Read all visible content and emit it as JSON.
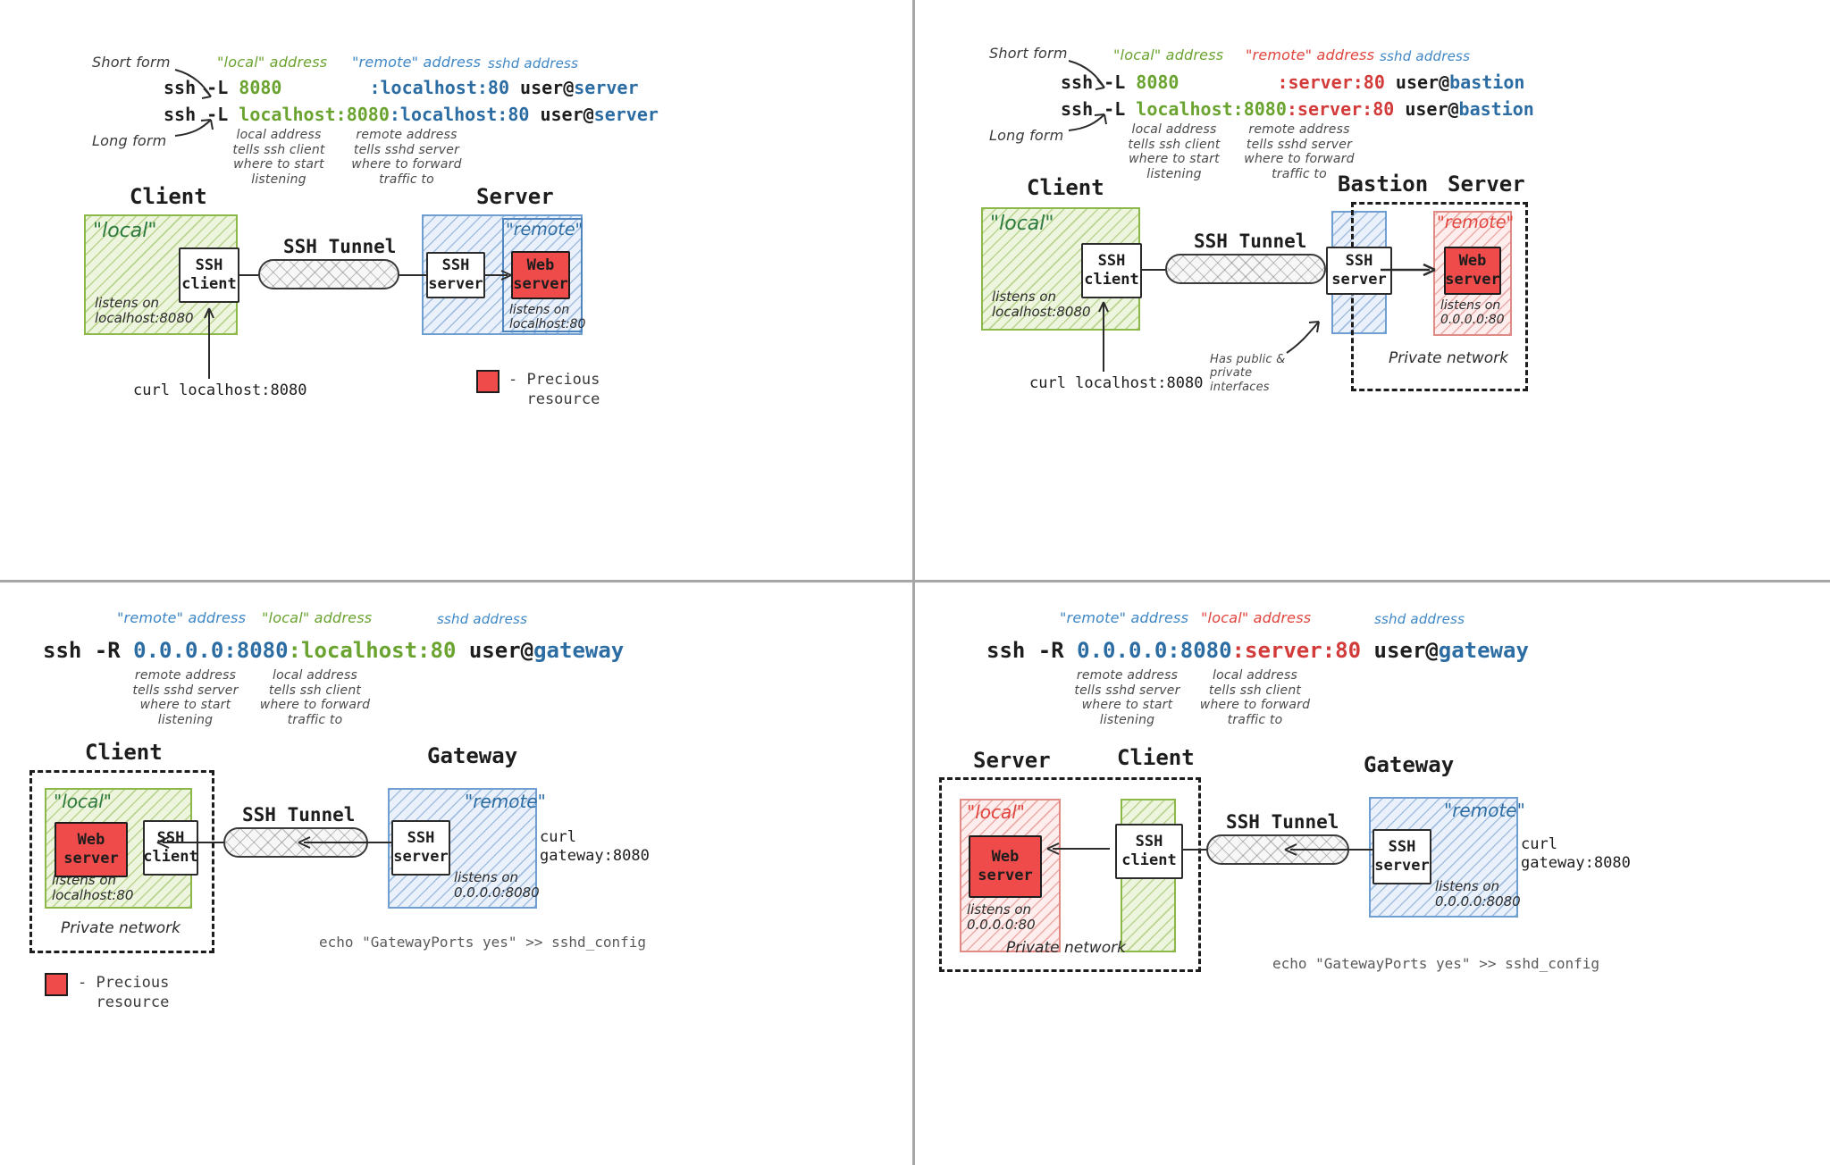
{
  "panels": {
    "top_left": {
      "labels": {
        "short_form": "Short form",
        "long_form": "Long form",
        "local_address": "\"local\" address",
        "remote_address": "\"remote\" address",
        "sshd_address": "sshd address"
      },
      "command_short": {
        "prefix": "ssh -L ",
        "local": "8080",
        "remote": ":localhost:80",
        "user": " user@",
        "host": "server"
      },
      "command_long": {
        "prefix": "ssh -L ",
        "local": "localhost:8080",
        "remote": ":localhost:80",
        "user": " user@",
        "host": "server"
      },
      "note_local": "local address\ntells ssh client\nwhere to start\nlistening",
      "note_remote": "remote address\ntells sshd server\nwhere to forward\ntraffic to",
      "host_left": "Client",
      "host_right": "Server",
      "zone_left_label": "\"local\"",
      "zone_right_label": "\"remote\"",
      "zone_left_note": "listens on\nlocalhost:8080",
      "zone_right_note": "listens on\nlocalhost:80",
      "node_ssh_client": "SSH\nclient",
      "node_ssh_server": "SSH\nserver",
      "node_web_server": "Web\nserver",
      "tunnel_label": "SSH Tunnel",
      "curl": "curl localhost:8080",
      "legend": "- Precious\n  resource"
    },
    "top_right": {
      "labels": {
        "short_form": "Short form",
        "long_form": "Long form",
        "local_address": "\"local\" address",
        "remote_address": "\"remote\" address",
        "sshd_address": "sshd address"
      },
      "command_short": {
        "prefix": "ssh -L ",
        "local": "8080",
        "remote": ":server:80",
        "user": " user@",
        "host": "bastion"
      },
      "command_long": {
        "prefix": "ssh -L ",
        "local": "localhost:8080",
        "remote": ":server:80",
        "user": " user@",
        "host": "bastion"
      },
      "note_local": "local address\ntells ssh client\nwhere to start\nlistening",
      "note_remote": "remote address\ntells sshd server\nwhere to forward\ntraffic to",
      "host_left": "Client",
      "host_mid": "Bastion",
      "host_right": "Server",
      "zone_left_label": "\"local\"",
      "zone_right_label": "\"remote\"",
      "zone_left_note": "listens on\nlocalhost:8080",
      "zone_right_note": "listens on\n0.0.0.0:80",
      "node_ssh_client": "SSH\nclient",
      "node_ssh_server": "SSH\nserver",
      "node_web_server": "Web\nserver",
      "tunnel_label": "SSH Tunnel",
      "curl": "curl localhost:8080",
      "bastion_note": "Has public & private\ninterfaces",
      "private_network": "Private network"
    },
    "bottom_left": {
      "labels": {
        "remote_address": "\"remote\" address",
        "local_address": "\"local\" address",
        "sshd_address": "sshd address"
      },
      "command": {
        "prefix": "ssh -R ",
        "remote": "0.0.0.0:8080",
        "local": ":localhost:80",
        "user": " user@",
        "host": "gateway"
      },
      "note_remote": "remote address\ntells sshd server\nwhere to start\nlistening",
      "note_local": "local address\ntells ssh client\nwhere to forward\ntraffic to",
      "host_left": "Client",
      "host_right": "Gateway",
      "zone_left_label": "\"local\"",
      "zone_right_label": "\"remote\"",
      "zone_left_note": "listens on\nlocalhost:80",
      "zone_right_note": "listens on\n0.0.0.0:8080",
      "node_ssh_client": "SSH\nclient",
      "node_ssh_server": "SSH\nserver",
      "node_web_server": "Web\nserver",
      "tunnel_label": "SSH Tunnel",
      "curl": "curl\ngateway:8080",
      "private_network": "Private network",
      "config": "echo \"GatewayPorts yes\" >> sshd_config",
      "legend": "- Precious\n  resource"
    },
    "bottom_right": {
      "labels": {
        "remote_address": "\"remote\" address",
        "local_address": "\"local\" address",
        "sshd_address": "sshd address"
      },
      "command": {
        "prefix": "ssh -R ",
        "remote": "0.0.0.0:8080",
        "local": ":server:80",
        "user": " user@",
        "host": "gateway"
      },
      "note_remote": "remote address\ntells sshd server\nwhere to start\nlistening",
      "note_local": "local address\ntells ssh client\nwhere to forward\ntraffic to",
      "host_left": "Server",
      "host_mid": "Client",
      "host_right": "Gateway",
      "zone_left_label": "\"local\"",
      "zone_right_label": "\"remote\"",
      "zone_left_note": "listens on\n0.0.0.0:80",
      "zone_right_note": "listens on\n0.0.0.0:8080",
      "node_ssh_client": "SSH\nclient",
      "node_ssh_server": "SSH\nserver",
      "node_web_server": "Web\nserver",
      "tunnel_label": "SSH Tunnel",
      "curl": "curl\ngateway:8080",
      "private_network": "Private network",
      "config": "echo \"GatewayPorts yes\" >> sshd_config"
    }
  },
  "colors": {
    "green": "#6aa32f",
    "blue": "#3d86c6",
    "red": "#e0443c",
    "precious": "#ef4b4b",
    "divider": "#a6a6a6"
  }
}
